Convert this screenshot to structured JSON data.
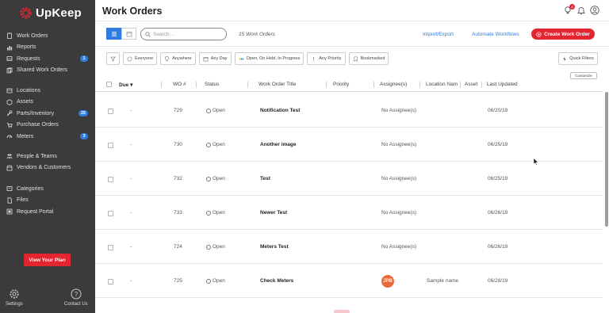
{
  "app": {
    "logo_text": "UpKeep",
    "brand_color": "#e2252f",
    "accent_color": "#2f7ce0"
  },
  "sidebar": {
    "groups": [
      [
        {
          "label": "Work Orders",
          "icon": "clipboard-icon"
        },
        {
          "label": "Reports",
          "icon": "chart-icon"
        },
        {
          "label": "Requests",
          "icon": "inbox-icon",
          "badge": "1"
        },
        {
          "label": "Shared Work Orders",
          "icon": "share-icon"
        }
      ],
      [
        {
          "label": "Locations",
          "icon": "location-icon"
        },
        {
          "label": "Assets",
          "icon": "cube-icon"
        },
        {
          "label": "Parts/Inventory",
          "icon": "wrench-icon",
          "badge": "25"
        },
        {
          "label": "Purchase Orders",
          "icon": "cart-icon"
        },
        {
          "label": "Meters",
          "icon": "gauge-icon",
          "badge": "3"
        }
      ],
      [
        {
          "label": "People & Teams",
          "icon": "people-icon"
        },
        {
          "label": "Vendors & Customers",
          "icon": "vendor-icon"
        }
      ],
      [
        {
          "label": "Categories",
          "icon": "tag-icon"
        },
        {
          "label": "Files",
          "icon": "file-icon"
        },
        {
          "label": "Request Portal",
          "icon": "portal-icon"
        }
      ]
    ],
    "plan_button": "View Your Plan",
    "settings_label": "Settings",
    "contact_label": "Contact Us"
  },
  "header": {
    "title": "Work Orders",
    "notification_count": "4"
  },
  "toolbar": {
    "search_placeholder": "Search...",
    "count_text": "15 Work Orders",
    "import_export": "Import/Export",
    "automate": "Automate Workflows",
    "create": "Create Work Order"
  },
  "filters": {
    "everyone": "Everyone",
    "anywhere": "Anywhere",
    "any_day": "Any Day",
    "status": "Open, On Hold, In Progress",
    "priority": "Any Priority",
    "bookmarked": "Bookmarked",
    "quick_filters": "Quick Filters",
    "customize": "Customize"
  },
  "table": {
    "columns": [
      "Due",
      "WO #",
      "Status",
      "Work Order Title",
      "Priority",
      "Assignee(s)",
      "Location Nam",
      "Asset",
      "Last Updated"
    ],
    "rows": [
      {
        "due": "-",
        "wo": "729",
        "status": "Open",
        "title": "Notification Test",
        "assignee": "No Assignee(s)",
        "location": "",
        "updated": "06/20/19"
      },
      {
        "due": "-",
        "wo": "730",
        "status": "Open",
        "title": "Another image",
        "assignee": "No Assignee(s)",
        "location": "",
        "updated": "06/25/19"
      },
      {
        "due": "-",
        "wo": "732",
        "status": "Open",
        "title": "Test",
        "assignee": "No Assignee(s)",
        "location": "",
        "updated": "06/25/19"
      },
      {
        "due": "-",
        "wo": "733",
        "status": "Open",
        "title": "Newer Test",
        "assignee": "No Assignee(s)",
        "location": "",
        "updated": "06/26/19"
      },
      {
        "due": "-",
        "wo": "724",
        "status": "Open",
        "title": "Meters Test",
        "assignee": "No Assignee(s)",
        "location": "",
        "updated": "06/26/19"
      },
      {
        "due": "-",
        "wo": "725",
        "status": "Open",
        "title": "Check Meters",
        "assignee": "",
        "assignee_avatar": "JPB",
        "location": "Sample name",
        "updated": "06/28/19"
      }
    ]
  }
}
